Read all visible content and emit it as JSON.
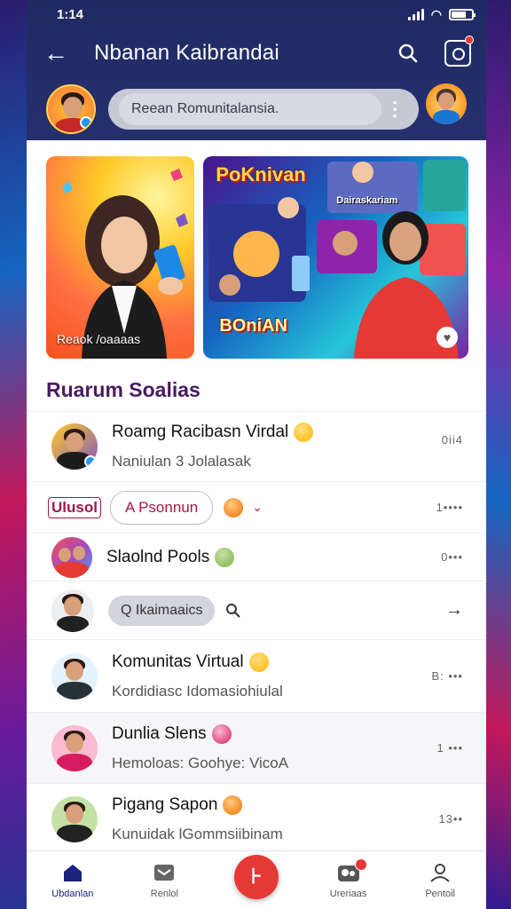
{
  "statusbar": {
    "time": "1:14"
  },
  "header": {
    "title": "Nbanan Kaibrandai",
    "search_placeholder": "Reean Romunitalansia."
  },
  "cards": [
    {
      "caption": "Reaok /oaaaas"
    },
    {
      "banner_top": "PoKnivan",
      "banner_mid": "Dairaskariam",
      "banner_bottom": "BOniAN"
    }
  ],
  "section": {
    "title": "Ruarum Soalias"
  },
  "rows": [
    {
      "name": "Roamg Racibasn Virdal",
      "sub": "Naniulan 3 Jolalasak",
      "meta": "0ii4",
      "emoji": "e-yellow"
    },
    {
      "tag": "Ulusol",
      "chip": "A Psonnun",
      "meta": "1••••"
    },
    {
      "name": "Slaolnd Pools",
      "meta": "0•••",
      "emoji": "e-green"
    },
    {
      "chip": "Q Ikaimaaics",
      "arrow": "→"
    },
    {
      "name": "Komunitas Virtual",
      "sub": "Kordidiasc Idomasiohiulal",
      "meta": "B: •••",
      "emoji": "e-yellow"
    },
    {
      "name": "Dunlia Slens",
      "sub": "Hemoloas: Goohye: VicoA",
      "meta": "1 •••",
      "emoji": "e-pink"
    },
    {
      "name": "Pigang Sapon",
      "sub": "Kunuidak lGommsiibinam",
      "meta": "13••",
      "emoji": "e-orange"
    }
  ],
  "tabs": [
    {
      "label": "Ubdanlan",
      "icon": "home-icon"
    },
    {
      "label": "Renlol",
      "icon": "inbox-icon"
    },
    {
      "label": "",
      "icon": "add-icon",
      "fab_glyph": "⊦"
    },
    {
      "label": "Ureriaas",
      "icon": "users-icon"
    },
    {
      "label": "Pentoil",
      "icon": "profile-icon"
    }
  ],
  "colors": {
    "header": "#1f2a63",
    "accent": "#e53935",
    "section_title": "#4a1a5e",
    "chip_text": "#a3174a"
  }
}
